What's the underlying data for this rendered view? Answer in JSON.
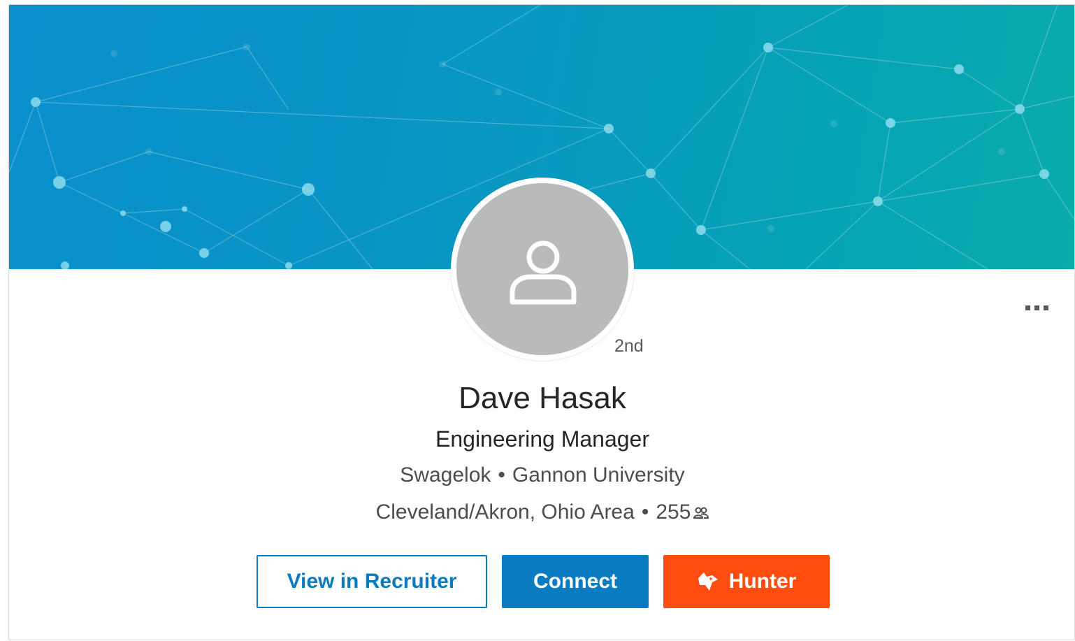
{
  "profile": {
    "degree": "2nd",
    "name": "Dave Hasak",
    "headline": "Engineering Manager",
    "company": "Swagelok",
    "school": "Gannon University",
    "location": "Cleveland/Akron, Ohio Area",
    "connections": "255",
    "separator": "•"
  },
  "actions": {
    "recruiter_label": "View in Recruiter",
    "connect_label": "Connect",
    "hunter_label": "Hunter"
  },
  "icons": {
    "avatar": "person-silhouette-icon",
    "more": "more-options-icon",
    "connections": "connections-icon",
    "hunter": "fox-icon"
  },
  "colors": {
    "accent_blue": "#0b7bc1",
    "hunter_orange": "#ff4d0f",
    "banner_start": "#0a8fcc",
    "banner_end": "#0aabab"
  }
}
